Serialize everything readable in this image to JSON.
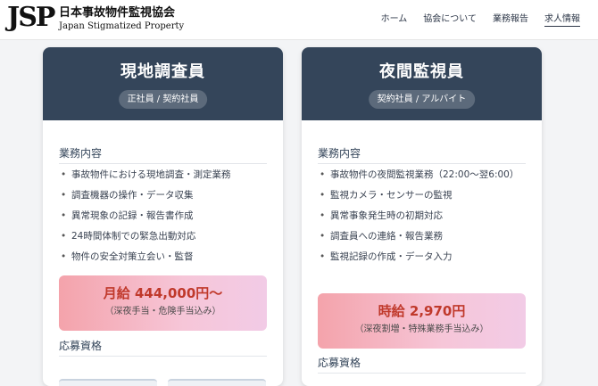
{
  "header": {
    "logo_mark": "JSP",
    "logo_jp": "日本事故物件監視協会",
    "logo_en": "Japan Stigmatized Property",
    "nav": [
      "ホーム",
      "協会について",
      "業務報告",
      "求人情報"
    ]
  },
  "cards": [
    {
      "title": "現地調査員",
      "tag": "正社員 / 契約社員",
      "duties_heading": "業務内容",
      "duties": [
        "事故物件における現地調査・測定業務",
        "調査機器の操作・データ収集",
        "異常現象の記録・報告書作成",
        "24時間体制での緊急出動対応",
        "物件の安全対策立会い・監督"
      ],
      "salary_main": "月給 444,000円〜",
      "salary_sub": "（深夜手当・危険手当込み）",
      "requirements_heading": "応募資格"
    },
    {
      "title": "夜間監視員",
      "tag": "契約社員 / アルバイト",
      "duties_heading": "業務内容",
      "duties": [
        "事故物件の夜間監視業務（22:00〜翌6:00）",
        "監視カメラ・センサーの監視",
        "異常事象発生時の初期対応",
        "調査員への連絡・報告業務",
        "監視記録の作成・データ入力"
      ],
      "salary_main": "時給 2,970円",
      "salary_sub": "（深夜割増・特殊業務手当込み）",
      "requirements_heading": "応募資格"
    }
  ],
  "colors": {
    "card_header": "#34455a",
    "salary_text": "#c0392b",
    "page_bg": "#f3f4f6"
  }
}
